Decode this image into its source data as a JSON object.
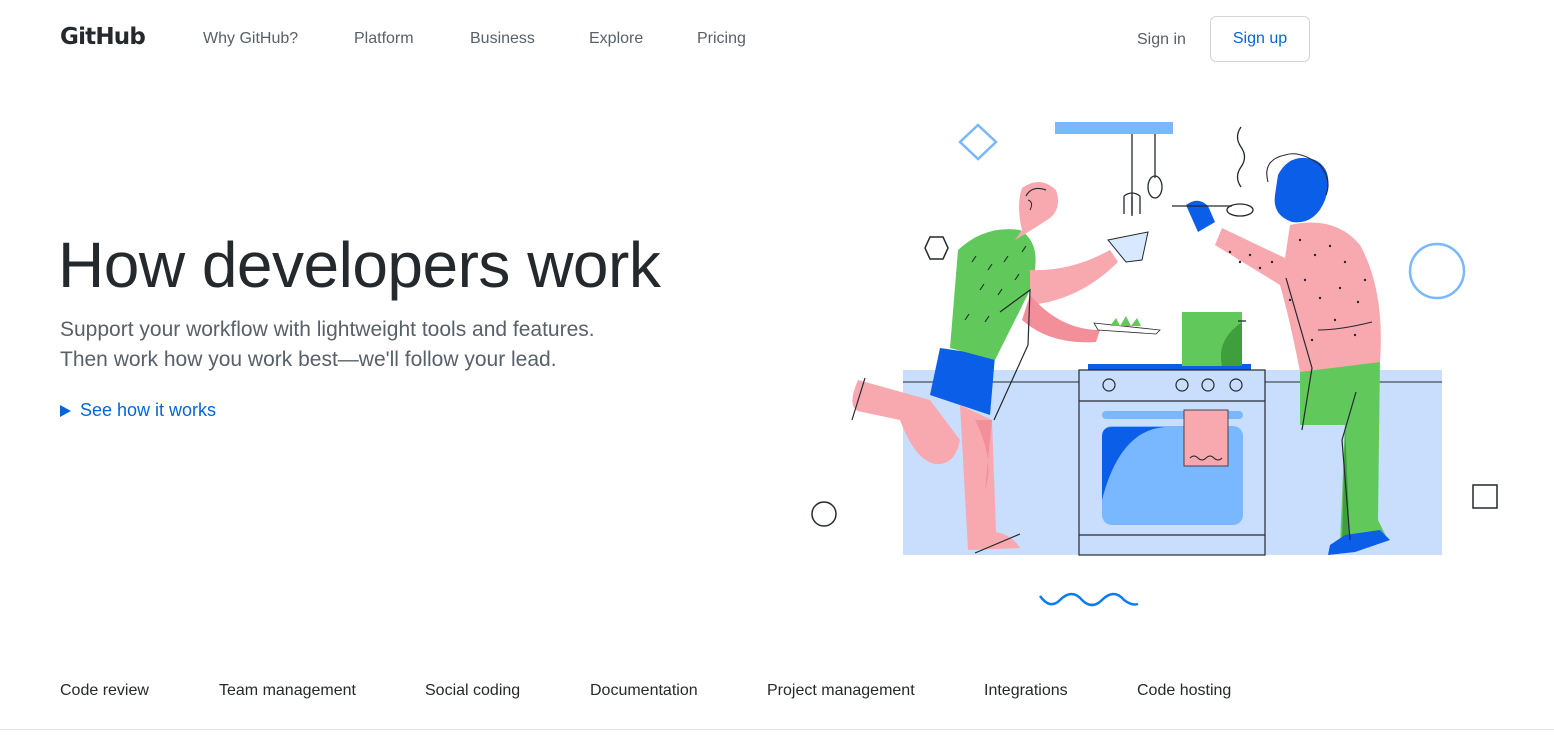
{
  "header": {
    "logo_text": "GitHub",
    "nav": [
      {
        "label": "Why GitHub?"
      },
      {
        "label": "Platform"
      },
      {
        "label": "Business"
      },
      {
        "label": "Explore"
      },
      {
        "label": "Pricing"
      }
    ],
    "sign_in_label": "Sign in",
    "sign_up_label": "Sign up"
  },
  "hero": {
    "title": "How developers work",
    "subtitle_line1": "Support your workflow with lightweight tools and features.",
    "subtitle_line2": "Then work how you work best—we'll follow your lead.",
    "cta_label": "See how it works",
    "cta_icon": "play-icon"
  },
  "feature_tabs": [
    {
      "label": "Code review"
    },
    {
      "label": "Team management"
    },
    {
      "label": "Social coding"
    },
    {
      "label": "Documentation"
    },
    {
      "label": "Project management"
    },
    {
      "label": "Integrations"
    },
    {
      "label": "Code hosting"
    }
  ],
  "colors": {
    "accent": "#0366d6",
    "illustration_light_blue": "#c8defc",
    "illustration_blue": "#0b5ee8",
    "illustration_pink": "#f8a9b0",
    "illustration_green": "#61c95c"
  }
}
